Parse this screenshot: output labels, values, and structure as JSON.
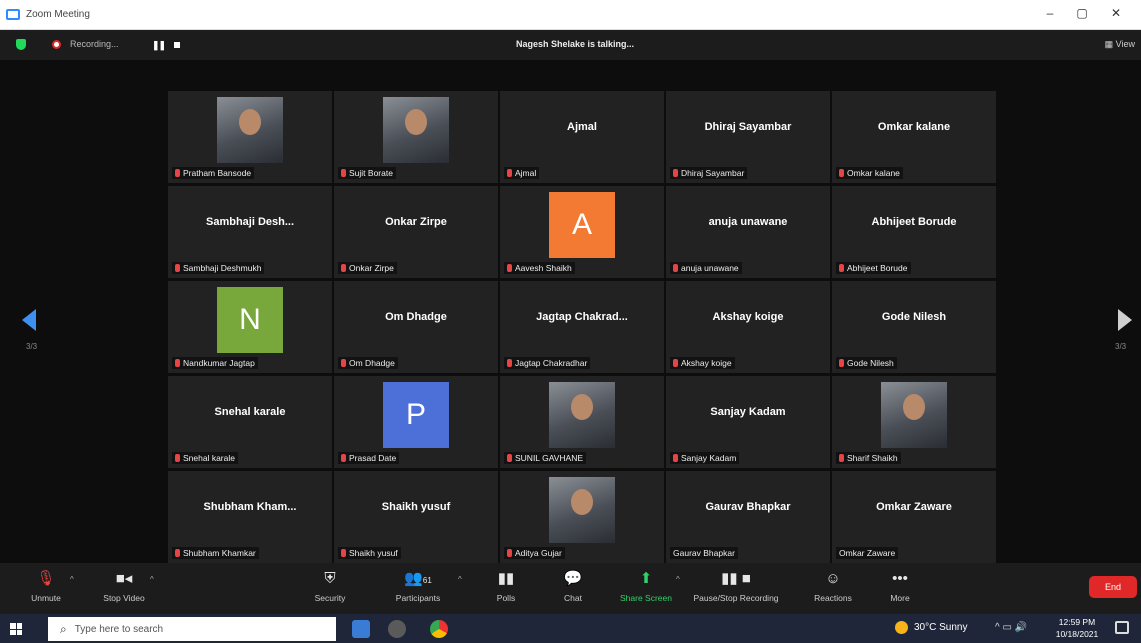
{
  "window": {
    "title": "Zoom Meeting",
    "minimize": "–",
    "restore": "▢",
    "close": "✕"
  },
  "topbar": {
    "recording": "Recording...",
    "talking": "Nagesh Shelake is talking...",
    "view": "View"
  },
  "colors": {
    "accent": "#2d8cff",
    "mic_muted": "#e54545",
    "end": "#e02828",
    "secure": "#23d959"
  },
  "pagination": {
    "left": "3/3",
    "right": "3/3"
  },
  "tiles": [
    {
      "name": "",
      "label": "Pratham Bansode",
      "kind": "photo"
    },
    {
      "name": "",
      "label": "Sujit Borate",
      "kind": "photo"
    },
    {
      "name": "Ajmal",
      "label": "Ajmal",
      "kind": "name"
    },
    {
      "name": "Dhiraj Sayambar",
      "label": "Dhiraj Sayambar",
      "kind": "name"
    },
    {
      "name": "Omkar kalane",
      "label": "Omkar kalane",
      "kind": "name"
    },
    {
      "name": "Sambhaji Desh...",
      "label": "Sambhaji Deshmukh",
      "kind": "name"
    },
    {
      "name": "Onkar Zirpe",
      "label": "Onkar Zirpe",
      "kind": "name"
    },
    {
      "name": "",
      "label": "Aavesh Shaikh",
      "kind": "avatar",
      "letter": "A",
      "color": "#f27a33"
    },
    {
      "name": "anuja unawane",
      "label": "anuja unawane",
      "kind": "name"
    },
    {
      "name": "Abhijeet Borude",
      "label": "Abhijeet Borude",
      "kind": "name"
    },
    {
      "name": "",
      "label": "Nandkumar Jagtap",
      "kind": "avatar",
      "letter": "N",
      "color": "#78a83b"
    },
    {
      "name": "Om Dhadge",
      "label": "Om Dhadge",
      "kind": "name"
    },
    {
      "name": "Jagtap Chakrad...",
      "label": "Jagtap Chakradhar",
      "kind": "name"
    },
    {
      "name": "Akshay koige",
      "label": "Akshay koige",
      "kind": "name"
    },
    {
      "name": "Gode Nilesh",
      "label": "Gode Nilesh",
      "kind": "name"
    },
    {
      "name": "Snehal karale",
      "label": "Snehal karale",
      "kind": "name"
    },
    {
      "name": "",
      "label": "Prasad Date",
      "kind": "avatar",
      "letter": "P",
      "color": "#4c6fd8"
    },
    {
      "name": "",
      "label": "SUNIL GAVHANE",
      "kind": "photo"
    },
    {
      "name": "Sanjay Kadam",
      "label": "Sanjay Kadam",
      "kind": "name"
    },
    {
      "name": "",
      "label": "Sharif Shaikh",
      "kind": "photo"
    },
    {
      "name": "Shubham Kham...",
      "label": "Shubham Khamkar",
      "kind": "name"
    },
    {
      "name": "Shaikh yusuf",
      "label": "Shaikh yusuf",
      "kind": "name"
    },
    {
      "name": "",
      "label": "Aditya Gujar",
      "kind": "photo"
    },
    {
      "name": "Gaurav Bhapkar",
      "label": "Gaurav Bhapkar",
      "kind": "name"
    },
    {
      "name": "Omkar Zaware",
      "label": "Omkar Zaware",
      "kind": "name"
    }
  ],
  "toolbar": {
    "unmute": "Unmute",
    "stop_video": "Stop Video",
    "security": "Security",
    "participants": "Participants",
    "participants_count": "61",
    "polls": "Polls",
    "chat": "Chat",
    "share_screen": "Share Screen",
    "pause_stop_recording": "Pause/Stop Recording",
    "reactions": "Reactions",
    "more": "More",
    "end": "End"
  },
  "taskbar": {
    "search_placeholder": "Type here to search",
    "weather": "30°C Sunny",
    "time": "12:59 PM",
    "date": "10/18/2021"
  }
}
